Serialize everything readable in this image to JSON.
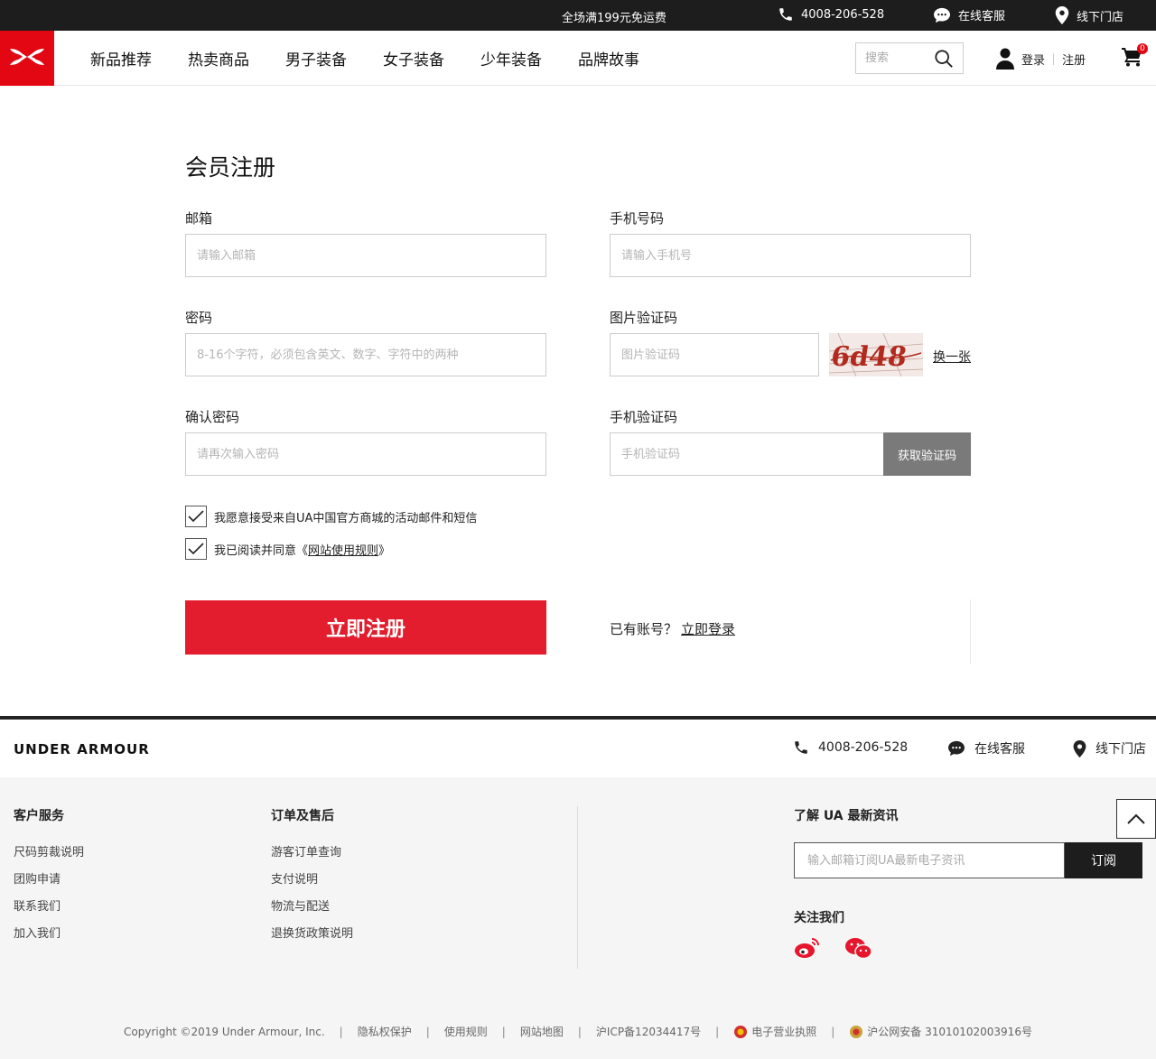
{
  "topbar": {
    "promo": "全场满199元免运费",
    "phone": "4008-206-528",
    "service": "在线客服",
    "stores": "线下门店"
  },
  "header": {
    "brand_icon": "under-armour-logo",
    "nav": [
      "新品推荐",
      "热卖商品",
      "男子装备",
      "女子装备",
      "少年装备",
      "品牌故事"
    ],
    "search_placeholder": "搜索",
    "login": "登录",
    "register": "注册",
    "cart_count": "0"
  },
  "form": {
    "title": "会员注册",
    "email_label": "邮箱",
    "email_placeholder": "请输入邮箱",
    "phone_label": "手机号码",
    "phone_placeholder": "请输入手机号",
    "password_label": "密码",
    "password_placeholder": "8-16个字符，必须包含英文、数字、字符中的两种",
    "captcha_label": "图片验证码",
    "captcha_placeholder": "图片验证码",
    "captcha_text": "6d48",
    "refresh": "换一张",
    "confirm_label": "确认密码",
    "confirm_placeholder": "请再次输入密码",
    "sms_label": "手机验证码",
    "sms_placeholder": "手机验证码",
    "get_code": "获取验证码",
    "consent_marketing": "我愿意接受来自UA中国官方商城的活动邮件和短信",
    "consent_terms_prefix": "我已阅读并同意《",
    "consent_terms_link": "网站使用规则",
    "consent_terms_suffix": "》",
    "submit": "立即注册",
    "have_account": "已有账号？",
    "login_now": "立即登录"
  },
  "footer": {
    "brand": "UNDER ARMOUR",
    "phone": "4008-206-528",
    "service": "在线客服",
    "stores": "线下门店",
    "col1": {
      "title": "客户服务",
      "items": [
        "尺码剪裁说明",
        "团购申请",
        "联系我们",
        "加入我们"
      ]
    },
    "col2": {
      "title": "订单及售后",
      "items": [
        "游客订单查询",
        "支付说明",
        "物流与配送",
        "退换货政策说明"
      ]
    },
    "newsletter_title": "了解 UA 最新资讯",
    "newsletter_placeholder": "输入邮箱订阅UA最新电子资讯",
    "subscribe": "订阅",
    "follow": "关注我们",
    "copyright": "Copyright ©2019 Under Armour, Inc.",
    "privacy": "隐私权保护",
    "terms": "使用规则",
    "sitemap": "网站地图",
    "icp": "沪ICP备12034417号",
    "license": "电子营业执照",
    "police": "沪公网安备 31010102003916号"
  },
  "colors": {
    "brand_red": "#e30613",
    "button_red": "#e31d2d",
    "dark": "#1d1d1d",
    "gray_button": "#7a7a7a"
  }
}
